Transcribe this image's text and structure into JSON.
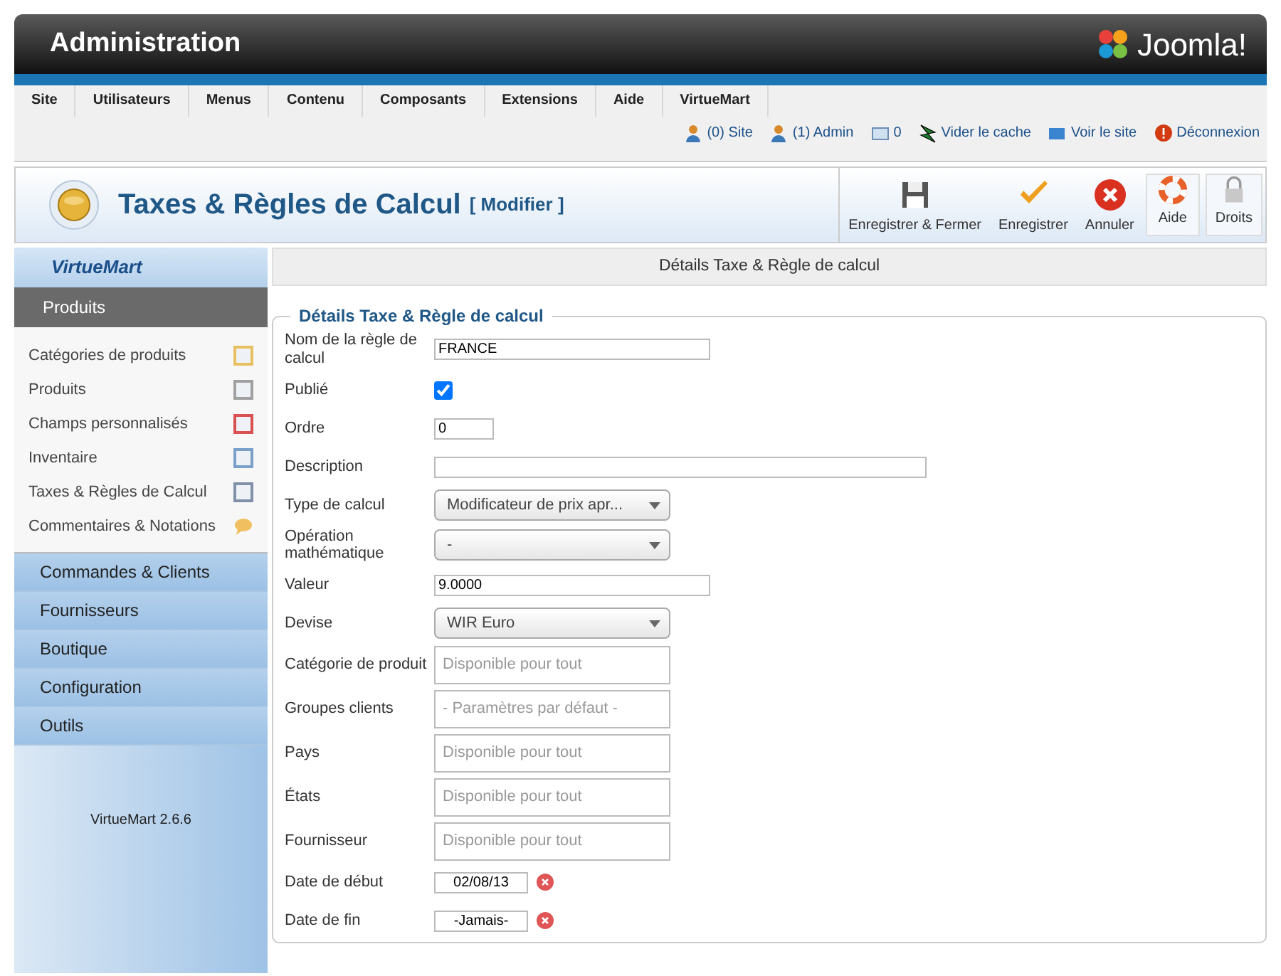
{
  "header": {
    "title": "Administration",
    "logo": "Joomla!"
  },
  "menu": [
    "Site",
    "Utilisateurs",
    "Menus",
    "Contenu",
    "Composants",
    "Extensions",
    "Aide",
    "VirtueMart"
  ],
  "status_links": [
    {
      "kind": "users",
      "text": "(0) Site"
    },
    {
      "kind": "admin",
      "text": "(1) Admin"
    },
    {
      "kind": "messages",
      "text": "0"
    },
    {
      "kind": "cache",
      "text": "Vider le cache"
    },
    {
      "kind": "site",
      "text": "Voir le site"
    },
    {
      "kind": "logout",
      "text": "Déconnexion"
    }
  ],
  "toolbar": {
    "title": "Taxes & Règles de Calcul",
    "subtitle": "[ Modifier ]",
    "buttons": [
      {
        "kind": "save-close",
        "label": "Enregistrer & Fermer"
      },
      {
        "kind": "save",
        "label": "Enregistrer"
      },
      {
        "kind": "cancel",
        "label": "Annuler"
      },
      {
        "kind": "help",
        "label": "Aide"
      },
      {
        "kind": "lock",
        "label": "Droits"
      }
    ]
  },
  "sidebar": {
    "logo": "VirtueMart",
    "open_section": "Produits",
    "items": [
      {
        "kind": "categories",
        "label": "Catégories de produits"
      },
      {
        "kind": "products",
        "label": "Produits"
      },
      {
        "kind": "fields",
        "label": "Champs personnalisés"
      },
      {
        "kind": "inventory",
        "label": "Inventaire"
      },
      {
        "kind": "taxes",
        "label": "Taxes & Règles de Calcul"
      },
      {
        "kind": "reviews",
        "label": "Commentaires & Notations"
      }
    ],
    "sections": [
      "Commandes & Clients",
      "Fournisseurs",
      "Boutique",
      "Configuration",
      "Outils"
    ],
    "version": "VirtueMart 2.6.6"
  },
  "content": {
    "heading": "Détails Taxe & Règle de calcul",
    "legend": "Détails Taxe & Règle de calcul",
    "fields": [
      {
        "kind": "text",
        "label": "Nom de la règle de calcul",
        "value": "FRANCE"
      },
      {
        "kind": "checkbox",
        "label": "Publié",
        "checked": true
      },
      {
        "kind": "short",
        "label": "Ordre",
        "value": "0"
      },
      {
        "kind": "wide",
        "label": "Description"
      },
      {
        "kind": "select",
        "label": "Type de calcul",
        "value": "Modificateur de prix apr..."
      },
      {
        "kind": "select",
        "label": "Opération mathématique",
        "value": "-"
      },
      {
        "kind": "text",
        "label": "Valeur",
        "value": "9.0000"
      },
      {
        "kind": "select",
        "label": "Devise",
        "value": "WIR Euro"
      },
      {
        "kind": "multi",
        "label": "Catégorie de produit",
        "placeholder": "Disponible pour tout"
      },
      {
        "kind": "multi",
        "label": "Groupes clients",
        "placeholder": "- Paramètres par défaut -"
      },
      {
        "kind": "multi",
        "label": "Pays",
        "placeholder": "Disponible pour tout"
      },
      {
        "kind": "multi",
        "label": "États",
        "placeholder": "Disponible pour tout"
      },
      {
        "kind": "multi",
        "label": "Fournisseur",
        "placeholder": "Disponible pour tout"
      },
      {
        "kind": "date",
        "label": "Date de début",
        "value": "02/08/13"
      },
      {
        "kind": "date",
        "label": "Date de fin",
        "value": "-Jamais-"
      }
    ]
  }
}
